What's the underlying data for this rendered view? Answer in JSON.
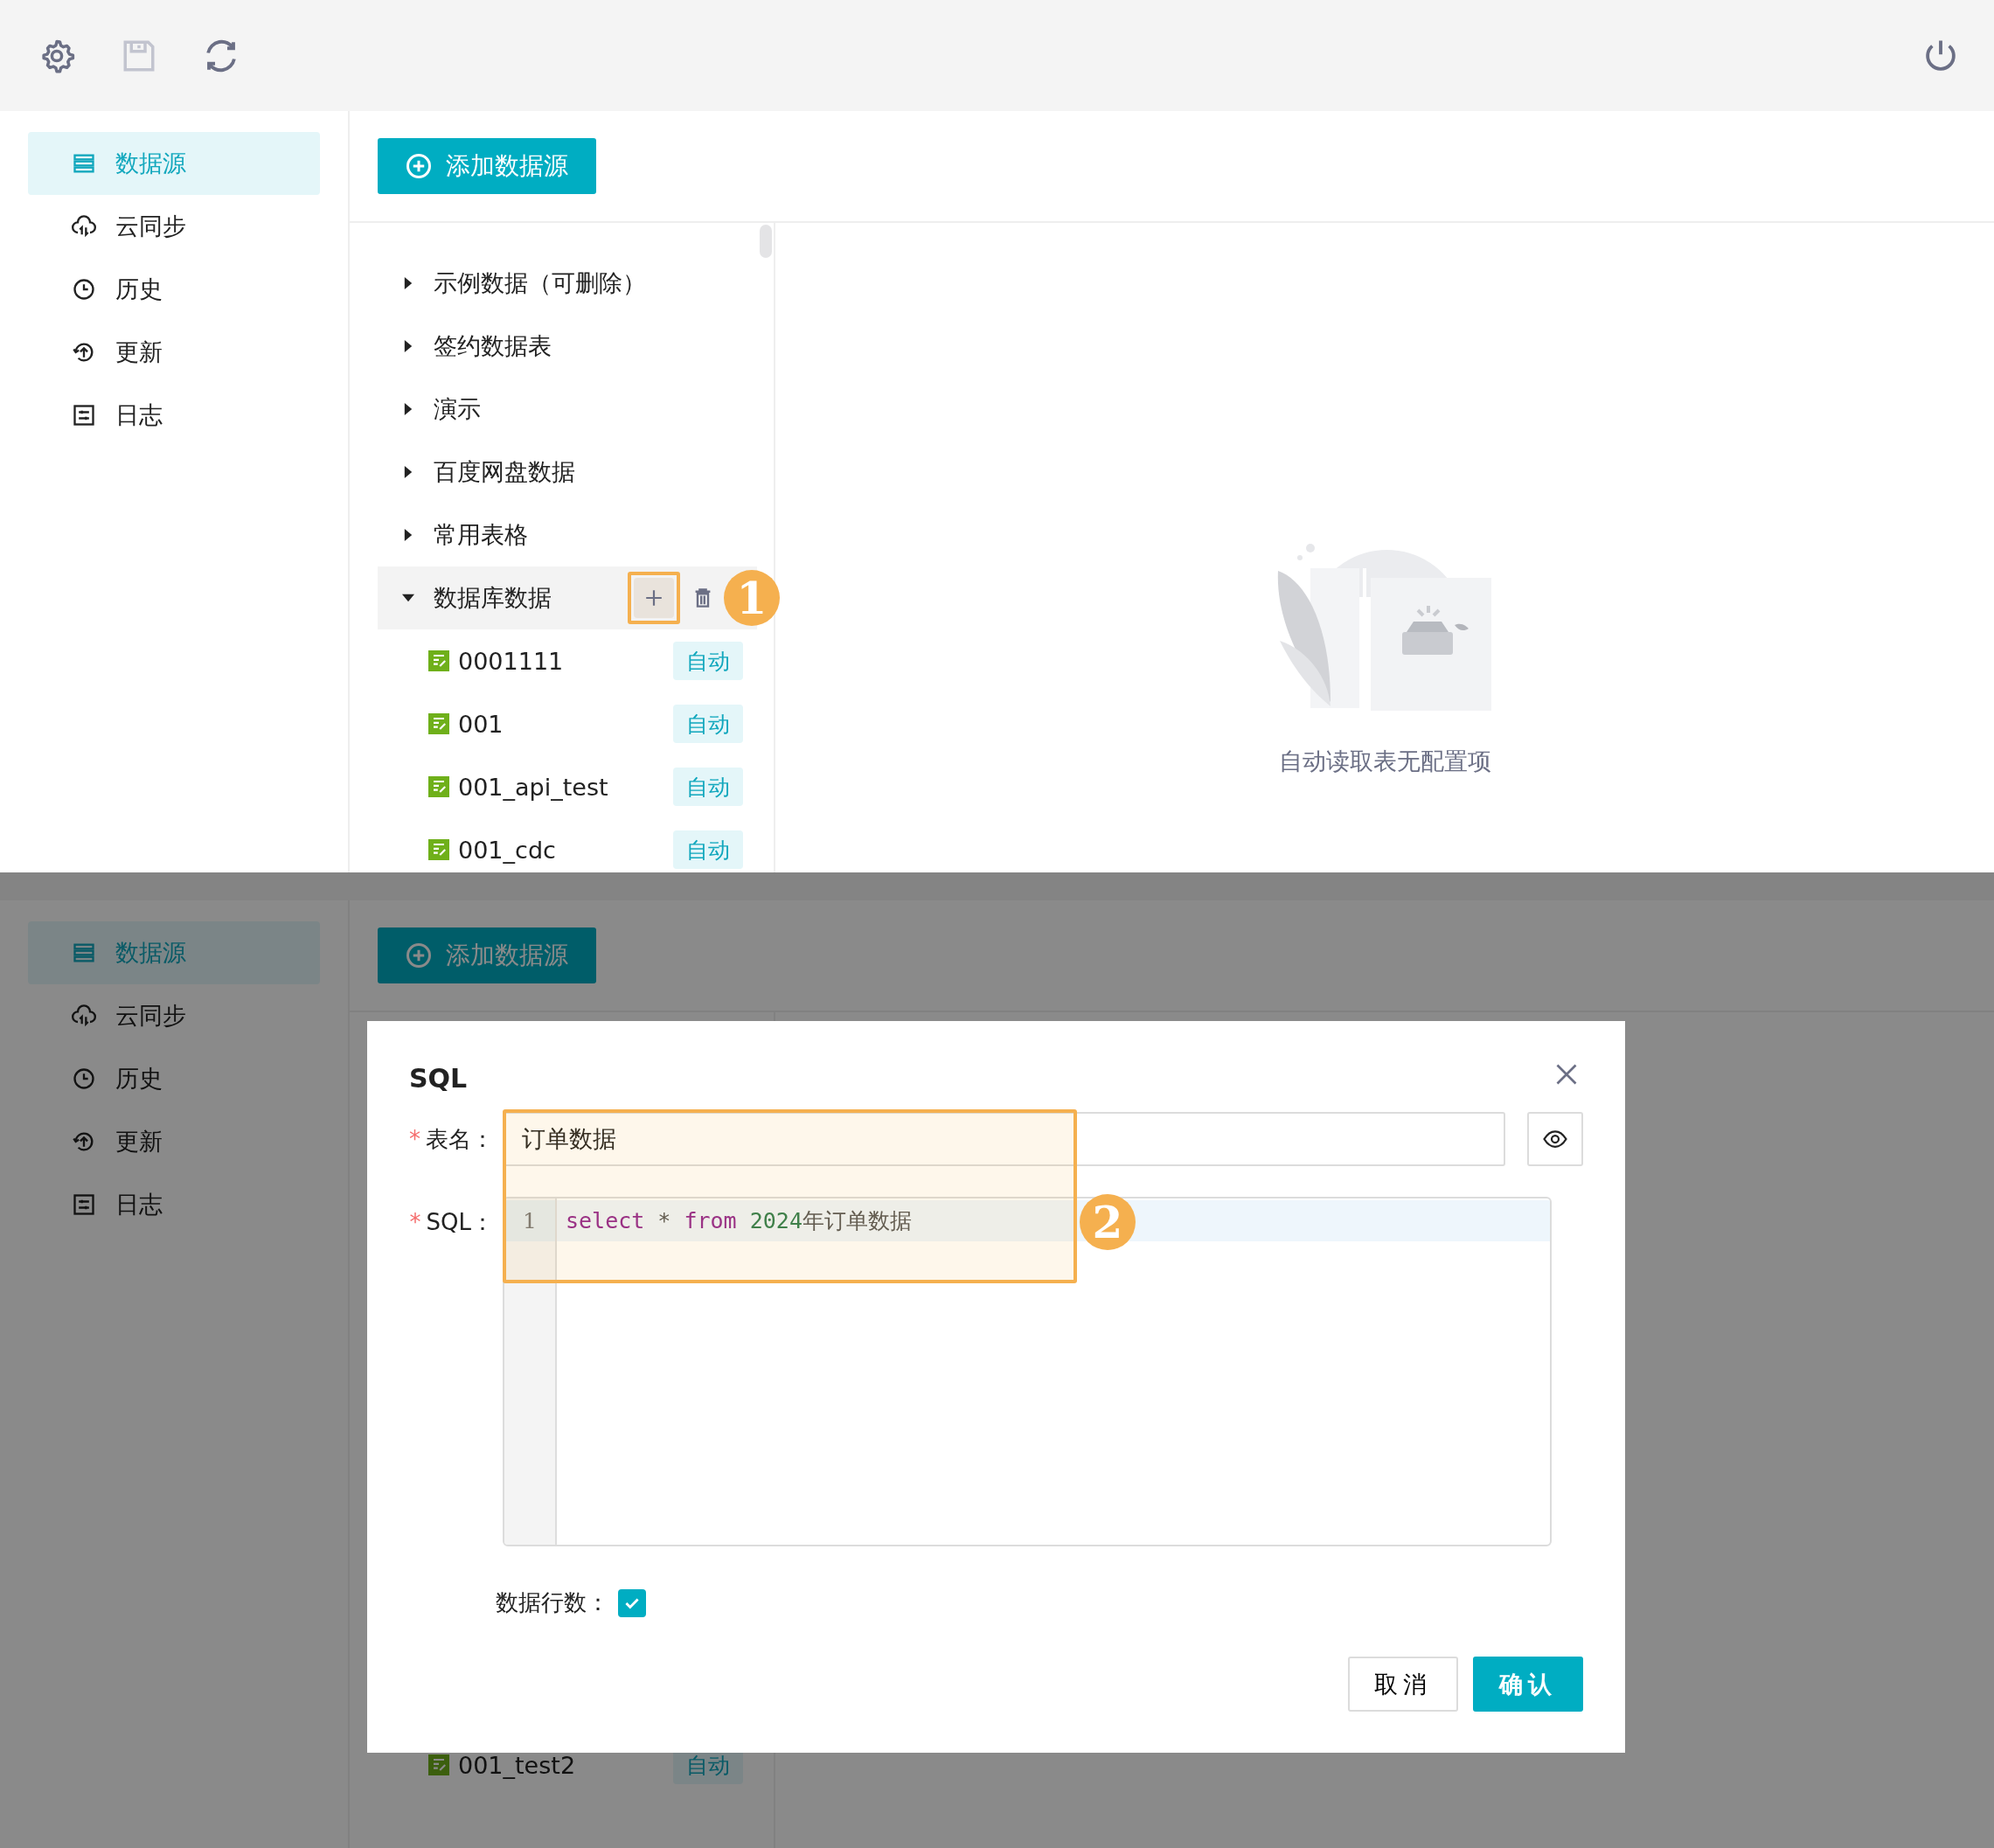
{
  "top_view": {
    "sidebar": {
      "items": [
        {
          "label": "数据源",
          "selected": true
        },
        {
          "label": "云同步",
          "selected": false
        },
        {
          "label": "历史",
          "selected": false
        },
        {
          "label": "更新",
          "selected": false
        },
        {
          "label": "日志",
          "selected": false
        }
      ]
    },
    "add_button": "添加数据源",
    "tree": [
      {
        "label": "示例数据（可删除）",
        "expanded": false,
        "selected": false
      },
      {
        "label": "签约数据表",
        "expanded": false,
        "selected": false
      },
      {
        "label": "演示",
        "expanded": false,
        "selected": false
      },
      {
        "label": "百度网盘数据",
        "expanded": false,
        "selected": false
      },
      {
        "label": "常用表格",
        "expanded": false,
        "selected": false
      },
      {
        "label": "数据库数据",
        "expanded": true,
        "selected": true,
        "children": [
          {
            "label": "0001111",
            "badge": "自动"
          },
          {
            "label": "001",
            "badge": "自动"
          },
          {
            "label": "001_api_test",
            "badge": "自动"
          },
          {
            "label": "001_cdc",
            "badge": "自动"
          }
        ]
      }
    ],
    "empty_state": "自动读取表无配置项",
    "callout": "1"
  },
  "bottom_view": {
    "sidebar": {
      "items": [
        {
          "label": "数据源",
          "selected": true
        },
        {
          "label": "云同步",
          "selected": false
        },
        {
          "label": "历史",
          "selected": false
        },
        {
          "label": "更新",
          "selected": false
        },
        {
          "label": "日志",
          "selected": false
        }
      ]
    },
    "add_button": "添加数据源",
    "tree_rows": [
      {
        "label": "001_test2",
        "badge": "自动"
      }
    ],
    "dialog": {
      "title": "SQL",
      "name_field": {
        "label": "表名：",
        "required": true,
        "value": "订单数据"
      },
      "sql_field": {
        "label": "SQL：",
        "required": true,
        "line_numbers": [
          "1"
        ],
        "tokens": [
          {
            "kind": "keyword",
            "text": "select"
          },
          {
            "kind": "plain",
            "text": " * "
          },
          {
            "kind": "keyword",
            "text": "from "
          },
          {
            "kind": "number",
            "text": "2024"
          },
          {
            "kind": "plain",
            "text": "年订单数据"
          }
        ]
      },
      "row_count": {
        "label": "数据行数：",
        "checked": true
      },
      "buttons": [
        "取消",
        "确认"
      ]
    },
    "callout": "2"
  }
}
